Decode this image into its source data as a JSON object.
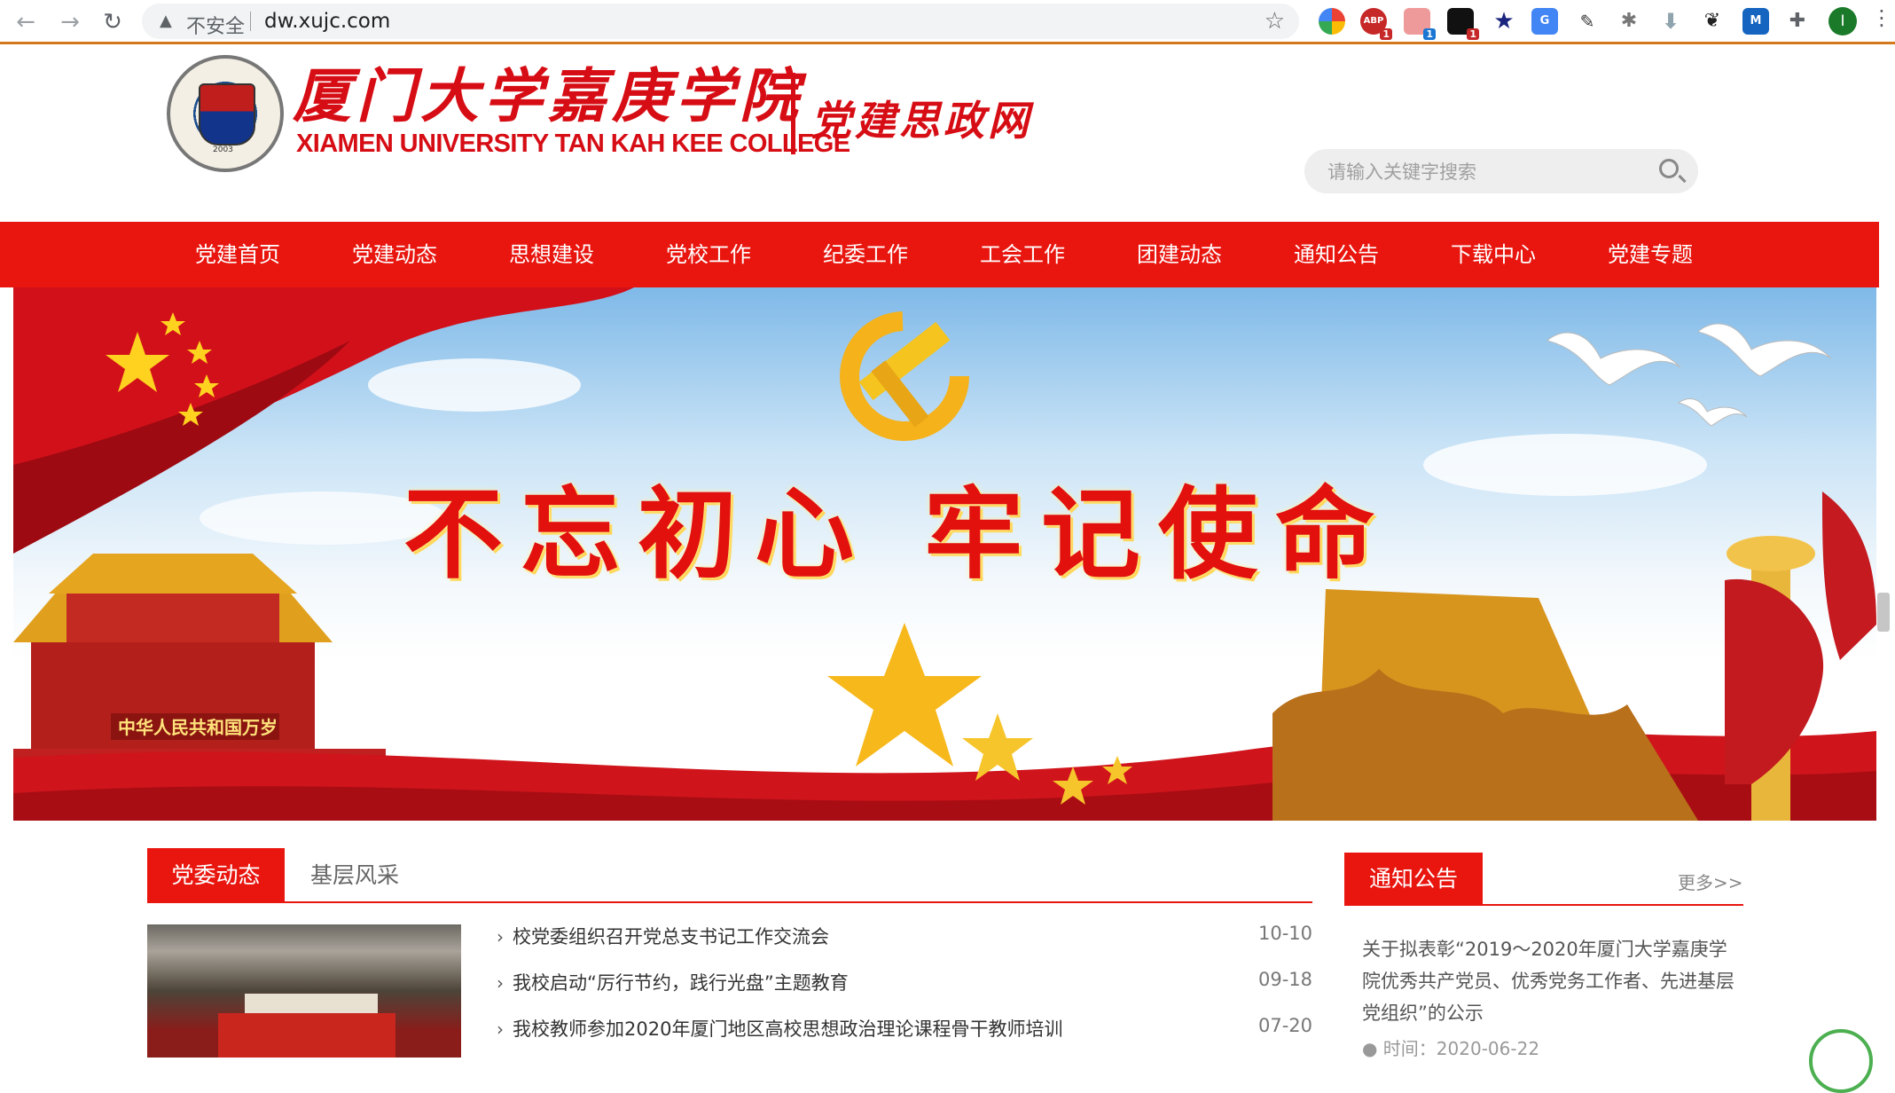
{
  "browser": {
    "insecure_label": "不安全",
    "url": "dw.xujc.com",
    "extension_badges": [
      "1",
      "1",
      "1"
    ],
    "extension_label_abp": "ABP",
    "extension_label_m": "M",
    "profile_initial": "I"
  },
  "header": {
    "logo_cn": "厦门大学嘉庚学院",
    "logo_en": "XIAMEN UNIVERSITY TAN KAH KEE COLLEGE",
    "site_name": "党建思政网",
    "seal_year": "2003",
    "search_placeholder": "请输入关键字搜索"
  },
  "nav": {
    "items": [
      "党建首页",
      "党建动态",
      "思想建设",
      "党校工作",
      "纪委工作",
      "工会工作",
      "团建动态",
      "通知公告",
      "下载中心",
      "党建专题"
    ]
  },
  "banner": {
    "slogan": "不忘初心 牢记使命",
    "gate_sign": "中华人民共和国万岁"
  },
  "news": {
    "tabs": [
      "党委动态",
      "基层风采"
    ],
    "items": [
      {
        "title": "校党委组织召开党总支书记工作交流会",
        "date": "10-10"
      },
      {
        "title": "我校启动“厉行节约，践行光盘”主题教育",
        "date": "09-18"
      },
      {
        "title": "我校教师参加2020年厦门地区高校思想政治理论课程骨干教师培训",
        "date": "07-20"
      }
    ]
  },
  "notice": {
    "title": "通知公告",
    "more": "更多>>",
    "item_text": "关于拟表彰“2019～2020年厦门大学嘉庚学院优秀共产党员、优秀党务工作者、先进基层党组织”的公示",
    "item_time": "● 时间：2020-06-22"
  },
  "colors": {
    "nav_red": "#e9160f",
    "logo_red": "#d60d14"
  }
}
